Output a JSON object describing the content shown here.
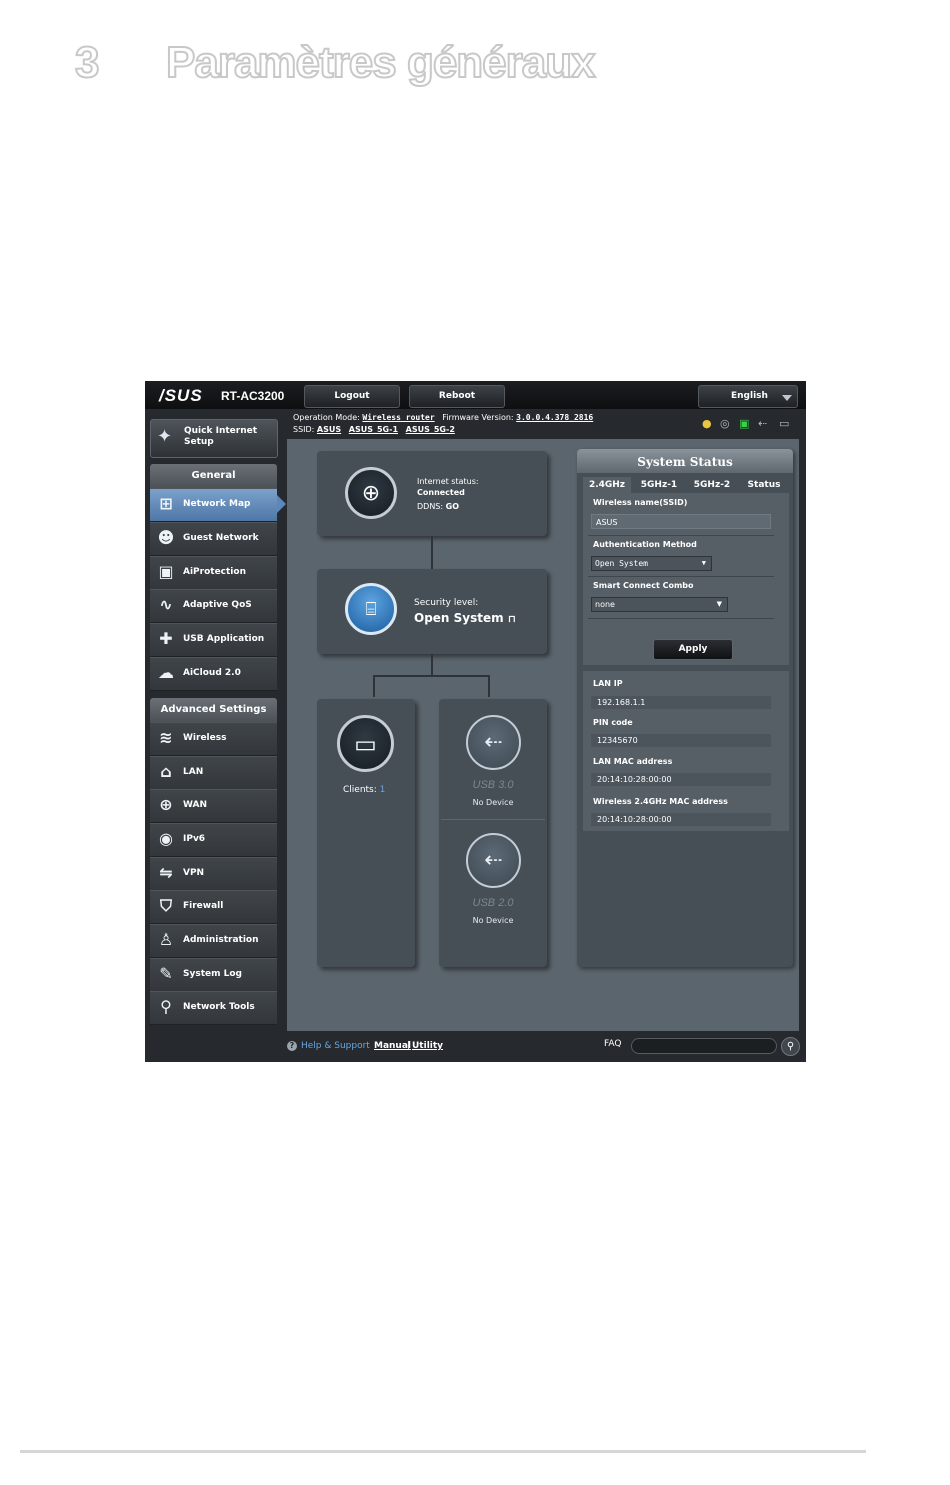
{
  "doc": {
    "chapter_number": "3",
    "chapter_title": "Paramètres généraux"
  },
  "topbar": {
    "logo": "/SUS",
    "model": "RT-AC3200",
    "logout": "Logout",
    "reboot": "Reboot",
    "language": "English"
  },
  "infobar": {
    "opmode_label": "Operation Mode:",
    "opmode_value": "Wireless router",
    "firmware_label": "Firmware Version:",
    "firmware_value": "3.0.0.4.378_2816",
    "ssid_label": "SSID:",
    "ssid_1": "ASUS",
    "ssid_2": "ASUS_5G-1",
    "ssid_3": "ASUS_5G-2"
  },
  "sidebar": {
    "qis": "Quick Internet Setup",
    "general_header": "General",
    "general_items": [
      {
        "label": "Network Map",
        "icon": "network-map-icon"
      },
      {
        "label": "Guest Network",
        "icon": "guest-network-icon"
      },
      {
        "label": "AiProtection",
        "icon": "lock-icon"
      },
      {
        "label": "Adaptive QoS",
        "icon": "qos-icon"
      },
      {
        "label": "USB Application",
        "icon": "puzzle-icon"
      },
      {
        "label": "AiCloud 2.0",
        "icon": "cloud-icon"
      }
    ],
    "advanced_header": "Advanced Settings",
    "advanced_items": [
      {
        "label": "Wireless",
        "icon": "wifi-icon"
      },
      {
        "label": "LAN",
        "icon": "home-icon"
      },
      {
        "label": "WAN",
        "icon": "globe-icon"
      },
      {
        "label": "IPv6",
        "icon": "ipv6-icon"
      },
      {
        "label": "VPN",
        "icon": "vpn-icon"
      },
      {
        "label": "Firewall",
        "icon": "shield-icon"
      },
      {
        "label": "Administration",
        "icon": "user-icon"
      },
      {
        "label": "System Log",
        "icon": "log-icon"
      },
      {
        "label": "Network Tools",
        "icon": "tools-icon"
      }
    ]
  },
  "map": {
    "internet_label": "Internet status:",
    "internet_value": "Connected",
    "ddns_label": "DDNS:",
    "ddns_value": "GO",
    "security_label": "Security level:",
    "security_value": "Open System",
    "clients_label": "Clients:",
    "clients_value": "1",
    "usb30": "USB 3.0",
    "usb20": "USB 2.0",
    "no_device": "No Device"
  },
  "status": {
    "title": "System Status",
    "tabs": [
      "2.4GHz",
      "5GHz-1",
      "5GHz-2",
      "Status"
    ],
    "ssid_label": "Wireless name(SSID)",
    "ssid_value": "ASUS",
    "auth_label": "Authentication Method",
    "auth_value": "Open System",
    "smart_label": "Smart Connect Combo",
    "smart_value": "none",
    "apply": "Apply",
    "lan_ip_label": "LAN IP",
    "lan_ip": "192.168.1.1",
    "pin_label": "PIN code",
    "pin": "12345670",
    "lan_mac_label": "LAN MAC address",
    "lan_mac": "20:14:10:28:00:00",
    "wmac_label": "Wireless 2.4GHz MAC address",
    "wmac": "20:14:10:28:00:00"
  },
  "footer": {
    "help": "Help & Support",
    "manual": "Manual",
    "sep": "|",
    "utility": "Utility",
    "faq": "FAQ"
  },
  "colors": {
    "active_menu": "#5c87b9",
    "panel": "#5b656d",
    "link_blue": "#68a7e2"
  }
}
